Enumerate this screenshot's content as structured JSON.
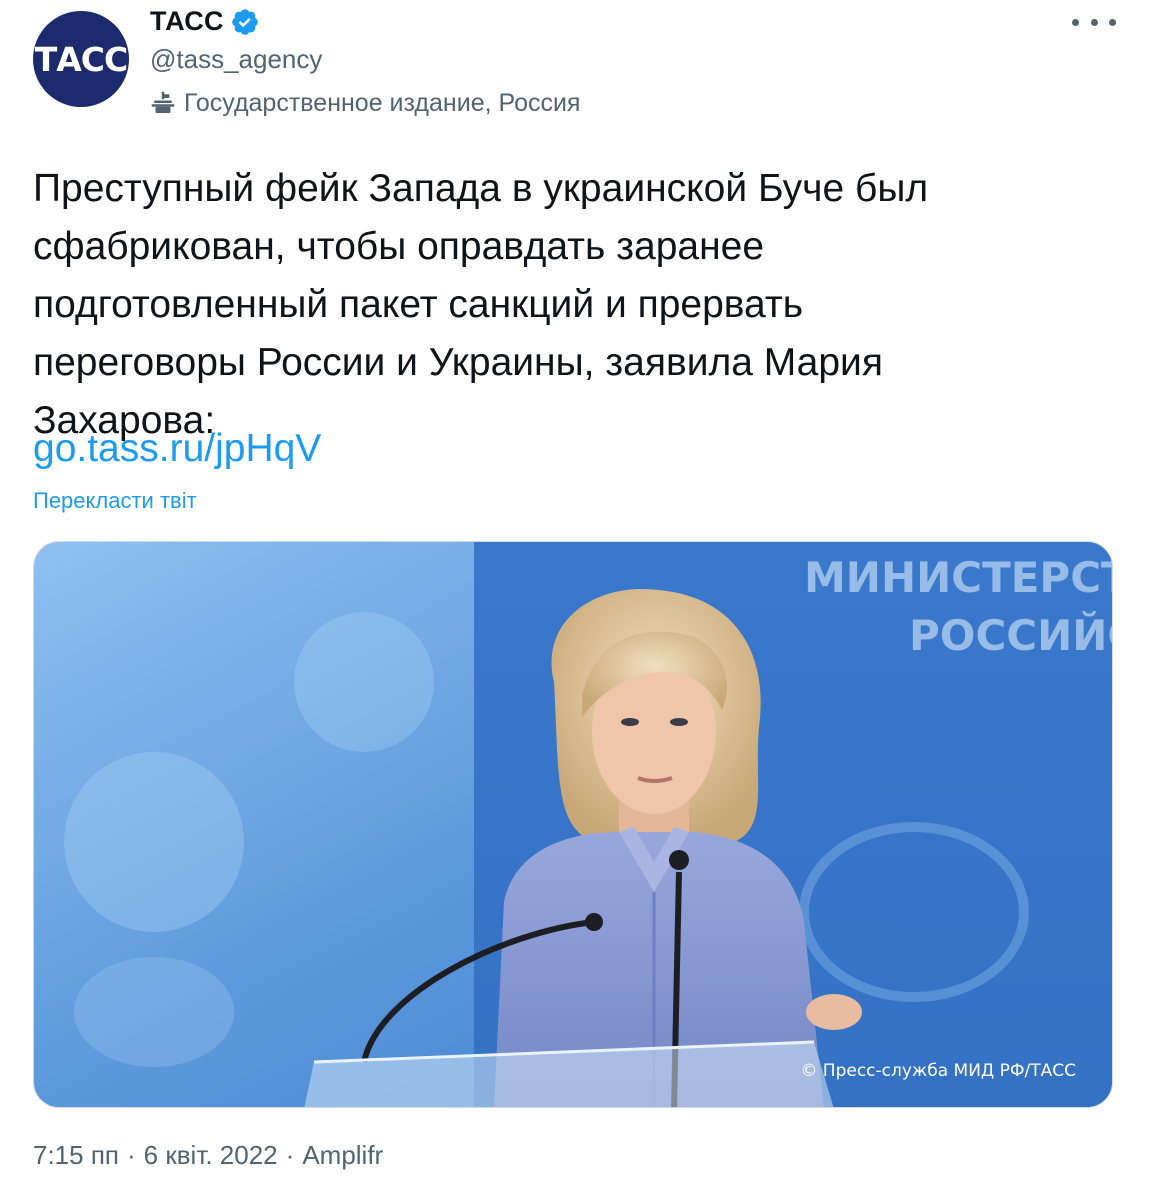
{
  "account": {
    "avatar_text": "ТАСС",
    "display_name": "ТАСС",
    "handle": "@tass_agency",
    "label": "Государственное издание, Россия"
  },
  "tweet": {
    "text": "Преступный фейк Запада в украинской Буче был\nсфабрикован, чтобы оправдать заранее\nподготовленный пакет санкций и прервать\nпереговоры России и Украины, заявила Мария\nЗахарова:",
    "link": "go.tass.ru/jpHqV",
    "translate_label": "Перекласти твіт"
  },
  "media": {
    "wall_text_line1": "МИНИСТЕРСТВО",
    "wall_text_line2": "РОССИЙСК",
    "credit": "© Пресс-служба МИД РФ/ТАСС"
  },
  "meta": {
    "time": "7:15 пп",
    "separator": "·",
    "date": "6 квіт. 2022",
    "source": "Amplifr"
  },
  "colors": {
    "accent": "#1d9bf0",
    "secondary_text": "#536471",
    "avatar_bg": "#1c2a6e",
    "photo_bg": "#3f7fd0"
  },
  "icons": {
    "verified": "verified-badge-icon",
    "state_media": "state-media-icon",
    "more": "more-options-icon"
  }
}
